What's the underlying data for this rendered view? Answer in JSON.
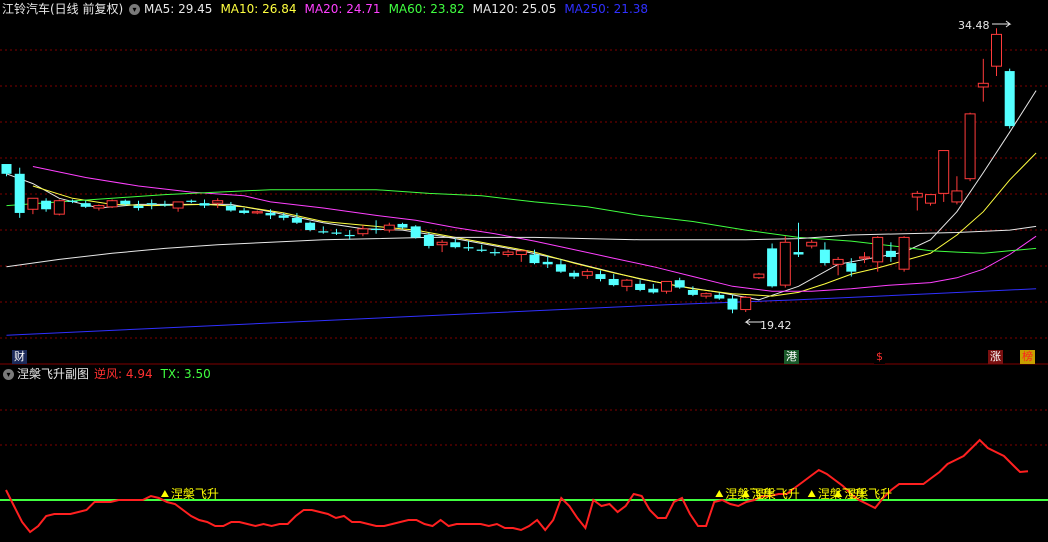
{
  "main_header": {
    "title": "江铃汽车(日线 前复权)",
    "menu_icon": "chevron-down-icon",
    "indicators": [
      {
        "label": "MA5:",
        "value": "29.45",
        "color": "#e8e8e8"
      },
      {
        "label": "MA10:",
        "value": "26.84",
        "color": "#ffff40"
      },
      {
        "label": "MA20:",
        "value": "24.71",
        "color": "#ff40ff"
      },
      {
        "label": "MA60:",
        "value": "23.82",
        "color": "#40ff40"
      },
      {
        "label": "MA120:",
        "value": "25.05",
        "color": "#e8e8e8"
      },
      {
        "label": "MA250:",
        "value": "21.38",
        "color": "#3030ff"
      }
    ]
  },
  "price_annotations": {
    "high": "34.48",
    "low": "19.42"
  },
  "event_tags": [
    {
      "text": "财",
      "bg": "#1c2a5a",
      "color": "#ffffff"
    },
    {
      "text": "港",
      "bg": "#1a5a2a",
      "color": "#ffffff"
    },
    {
      "text": "$",
      "bg": "#000000",
      "color": "#ff3030"
    },
    {
      "text": "涨",
      "bg": "#7a1010",
      "color": "#ffffff"
    },
    {
      "text": "榜",
      "bg": "#c8a000",
      "color": "#ff2020"
    }
  ],
  "sub_header": {
    "title": "涅槃飞升副图",
    "menu_icon": "chevron-down-icon",
    "indicators": [
      {
        "label": "逆风:",
        "value": "4.94",
        "color": "#ff3030"
      },
      {
        "label": "TX:",
        "value": "3.50",
        "color": "#40ff40"
      }
    ]
  },
  "signal_label": "涅槃飞升",
  "colors": {
    "up": "#ff3b3b",
    "down": "#54ffff",
    "grid": "#800000",
    "signal": "#ffff00",
    "threshold": "#40ff40",
    "indicator": "#ff2020"
  },
  "chart_data": {
    "type": "candlestick",
    "ohlc": [
      [
        23.4,
        23.2,
        22.4,
        22.6
      ],
      [
        22.6,
        23.1,
        19.0,
        19.4
      ],
      [
        19.7,
        20.6,
        19.3,
        20.6
      ],
      [
        20.4,
        20.6,
        19.5,
        19.7
      ],
      [
        19.3,
        20.5,
        19.2,
        20.4
      ],
      [
        20.4,
        20.5,
        20.2,
        20.3
      ],
      [
        20.2,
        20.4,
        19.8,
        19.9
      ],
      [
        19.8,
        20.1,
        19.6,
        20.0
      ],
      [
        19.9,
        20.5,
        19.8,
        20.4
      ],
      [
        20.4,
        20.5,
        20.0,
        20.1
      ],
      [
        20.0,
        20.4,
        19.6,
        19.8
      ],
      [
        20.2,
        20.5,
        19.7,
        20.1
      ],
      [
        20.1,
        20.4,
        19.9,
        20.0
      ],
      [
        19.8,
        20.3,
        19.5,
        20.3
      ],
      [
        20.4,
        20.5,
        20.2,
        20.3
      ],
      [
        20.2,
        20.5,
        19.8,
        20.0
      ],
      [
        20.2,
        20.6,
        19.8,
        20.4
      ],
      [
        20.0,
        20.3,
        19.5,
        19.6
      ],
      [
        19.6,
        19.8,
        19.3,
        19.4
      ],
      [
        19.4,
        19.6,
        19.3,
        19.5
      ],
      [
        19.4,
        19.7,
        18.9,
        19.2
      ],
      [
        19.2,
        19.4,
        18.8,
        19.0
      ],
      [
        19.0,
        19.4,
        18.5,
        18.6
      ],
      [
        18.6,
        18.7,
        17.9,
        18.0
      ],
      [
        17.9,
        18.3,
        17.7,
        17.8
      ],
      [
        17.8,
        18.1,
        17.6,
        17.7
      ],
      [
        17.6,
        18.0,
        17.2,
        17.5
      ],
      [
        17.7,
        18.4,
        17.5,
        18.1
      ],
      [
        18.1,
        18.8,
        17.7,
        18.0
      ],
      [
        18.0,
        18.6,
        17.8,
        18.4
      ],
      [
        18.5,
        18.6,
        18.1,
        18.2
      ],
      [
        18.3,
        18.4,
        17.3,
        17.4
      ],
      [
        17.6,
        17.8,
        16.5,
        16.7
      ],
      [
        16.8,
        17.2,
        16.2,
        17.0
      ],
      [
        17.0,
        17.3,
        16.5,
        16.6
      ],
      [
        16.6,
        17.1,
        16.3,
        16.5
      ],
      [
        16.4,
        16.8,
        16.2,
        16.3
      ],
      [
        16.2,
        16.5,
        15.9,
        16.1
      ],
      [
        16.0,
        16.4,
        15.8,
        16.2
      ],
      [
        16.0,
        16.3,
        15.4,
        16.3
      ],
      [
        16.0,
        16.4,
        15.2,
        15.3
      ],
      [
        15.4,
        15.9,
        14.9,
        15.2
      ],
      [
        15.2,
        15.6,
        14.5,
        14.6
      ],
      [
        14.5,
        14.7,
        14.0,
        14.2
      ],
      [
        14.3,
        14.8,
        14.0,
        14.6
      ],
      [
        14.4,
        14.7,
        13.8,
        14.0
      ],
      [
        14.0,
        14.4,
        13.4,
        13.5
      ],
      [
        13.4,
        14.0,
        13.0,
        13.9
      ],
      [
        13.6,
        13.9,
        13.0,
        13.1
      ],
      [
        13.2,
        13.6,
        12.8,
        12.9
      ],
      [
        13.0,
        13.8,
        12.8,
        13.8
      ],
      [
        13.9,
        14.1,
        13.2,
        13.3
      ],
      [
        13.1,
        13.4,
        12.6,
        12.7
      ],
      [
        12.6,
        12.9,
        12.4,
        12.8
      ],
      [
        12.7,
        12.9,
        12.3,
        12.4
      ],
      [
        12.4,
        12.7,
        11.2,
        11.5
      ],
      [
        11.5,
        12.6,
        11.3,
        12.5
      ],
      [
        14.1,
        14.5,
        14.0,
        14.4
      ],
      [
        16.5,
        16.9,
        13.3,
        13.4
      ],
      [
        13.5,
        17.5,
        13.3,
        17.0
      ],
      [
        16.2,
        18.6,
        15.8,
        16.0
      ],
      [
        16.7,
        17.2,
        16.5,
        17.0
      ],
      [
        16.4,
        17.0,
        15.1,
        15.3
      ],
      [
        15.2,
        15.8,
        14.3,
        15.6
      ],
      [
        15.3,
        15.7,
        14.2,
        14.6
      ],
      [
        15.7,
        16.2,
        15.3,
        15.8
      ],
      [
        15.4,
        17.5,
        14.6,
        17.4
      ],
      [
        16.3,
        17.0,
        15.4,
        15.8
      ],
      [
        14.8,
        17.5,
        14.6,
        17.4
      ],
      [
        20.7,
        21.2,
        19.6,
        21.0
      ],
      [
        20.2,
        20.9,
        20.0,
        20.9
      ],
      [
        21.0,
        24.5,
        20.3,
        24.5
      ],
      [
        20.3,
        22.4,
        20.1,
        21.2
      ],
      [
        22.2,
        27.6,
        22.0,
        27.5
      ],
      [
        29.7,
        32.0,
        28.5,
        30.0
      ],
      [
        31.4,
        34.5,
        30.6,
        34.0
      ],
      [
        31.0,
        31.2,
        26.3,
        26.5
      ]
    ],
    "ma": [
      {
        "name": "MA5",
        "color": "#e8e8e8",
        "pts": [
          [
            0,
            22.6
          ],
          [
            2,
            21.8
          ],
          [
            4,
            20.6
          ],
          [
            7,
            19.8
          ],
          [
            10,
            20.1
          ],
          [
            14,
            20.1
          ],
          [
            17,
            20.1
          ],
          [
            20,
            19.5
          ],
          [
            24,
            18.6
          ],
          [
            27,
            18.1
          ],
          [
            30,
            18.0
          ],
          [
            33,
            17.5
          ],
          [
            36,
            16.9
          ],
          [
            39,
            16.3
          ],
          [
            42,
            15.6
          ],
          [
            45,
            14.8
          ],
          [
            48,
            14.0
          ],
          [
            51,
            13.4
          ],
          [
            54,
            12.9
          ],
          [
            57,
            12.3
          ],
          [
            60,
            13.4
          ],
          [
            63,
            15.2
          ],
          [
            66,
            15.8
          ],
          [
            68,
            16.2
          ],
          [
            70,
            17.2
          ],
          [
            72,
            19.5
          ],
          [
            74,
            22.7
          ],
          [
            76,
            26.0
          ],
          [
            78,
            29.4
          ]
        ]
      },
      {
        "name": "MA10",
        "color": "#ffff40",
        "pts": [
          [
            2,
            21.6
          ],
          [
            5,
            20.6
          ],
          [
            8,
            20.1
          ],
          [
            11,
            20.0
          ],
          [
            15,
            20.1
          ],
          [
            18,
            19.9
          ],
          [
            21,
            19.4
          ],
          [
            24,
            18.7
          ],
          [
            28,
            18.3
          ],
          [
            31,
            18.0
          ],
          [
            34,
            17.4
          ],
          [
            37,
            16.8
          ],
          [
            40,
            16.2
          ],
          [
            43,
            15.3
          ],
          [
            46,
            14.5
          ],
          [
            49,
            13.8
          ],
          [
            52,
            13.2
          ],
          [
            55,
            12.8
          ],
          [
            58,
            12.6
          ],
          [
            60,
            12.9
          ],
          [
            62,
            13.6
          ],
          [
            64,
            14.4
          ],
          [
            66,
            14.9
          ],
          [
            68,
            15.5
          ],
          [
            70,
            16.1
          ],
          [
            72,
            17.6
          ],
          [
            74,
            19.5
          ],
          [
            76,
            22.1
          ],
          [
            78,
            24.3
          ]
        ]
      },
      {
        "name": "MA20",
        "color": "#ff40ff",
        "pts": [
          [
            2,
            23.2
          ],
          [
            6,
            22.3
          ],
          [
            10,
            21.6
          ],
          [
            14,
            21.1
          ],
          [
            18,
            20.8
          ],
          [
            20,
            20.3
          ],
          [
            24,
            19.8
          ],
          [
            28,
            19.2
          ],
          [
            31,
            18.8
          ],
          [
            34,
            18.2
          ],
          [
            37,
            17.7
          ],
          [
            40,
            17.1
          ],
          [
            43,
            16.4
          ],
          [
            46,
            15.7
          ],
          [
            49,
            15.0
          ],
          [
            52,
            14.2
          ],
          [
            55,
            13.4
          ],
          [
            58,
            13.0
          ],
          [
            61,
            13.0
          ],
          [
            64,
            13.2
          ],
          [
            67,
            13.5
          ],
          [
            70,
            13.7
          ],
          [
            72,
            14.1
          ],
          [
            74,
            14.8
          ],
          [
            76,
            16.0
          ],
          [
            78,
            17.5
          ]
        ]
      },
      {
        "name": "MA60",
        "color": "#40ff40",
        "pts": [
          [
            0,
            20.0
          ],
          [
            4,
            20.3
          ],
          [
            8,
            20.6
          ],
          [
            12,
            20.9
          ],
          [
            16,
            21.1
          ],
          [
            20,
            21.3
          ],
          [
            24,
            21.3
          ],
          [
            28,
            21.3
          ],
          [
            32,
            21.0
          ],
          [
            36,
            20.8
          ],
          [
            40,
            20.3
          ],
          [
            44,
            19.9
          ],
          [
            48,
            19.2
          ],
          [
            52,
            18.7
          ],
          [
            56,
            18.0
          ],
          [
            60,
            17.4
          ],
          [
            64,
            17.1
          ],
          [
            68,
            16.6
          ],
          [
            70,
            16.3
          ],
          [
            72,
            16.2
          ],
          [
            74,
            16.1
          ],
          [
            76,
            16.3
          ],
          [
            78,
            16.5
          ]
        ]
      },
      {
        "name": "MA120",
        "color": "#e8e8e8",
        "pts": [
          [
            0,
            15.0
          ],
          [
            4,
            15.6
          ],
          [
            8,
            16.1
          ],
          [
            12,
            16.5
          ],
          [
            16,
            16.8
          ],
          [
            20,
            17.0
          ],
          [
            24,
            17.2
          ],
          [
            28,
            17.3
          ],
          [
            32,
            17.4
          ],
          [
            36,
            17.4
          ],
          [
            40,
            17.4
          ],
          [
            44,
            17.3
          ],
          [
            48,
            17.2
          ],
          [
            52,
            17.2
          ],
          [
            56,
            17.2
          ],
          [
            60,
            17.3
          ],
          [
            64,
            17.6
          ],
          [
            68,
            17.7
          ],
          [
            72,
            17.8
          ],
          [
            76,
            18.0
          ],
          [
            78,
            18.3
          ]
        ]
      },
      {
        "name": "MA250",
        "color": "#3030ff",
        "pts": [
          [
            0,
            9.4
          ],
          [
            10,
            9.9
          ],
          [
            20,
            10.4
          ],
          [
            30,
            10.9
          ],
          [
            40,
            11.4
          ],
          [
            50,
            11.9
          ],
          [
            60,
            12.3
          ],
          [
            70,
            12.8
          ],
          [
            78,
            13.2
          ]
        ]
      }
    ],
    "oscillator": {
      "name": "逆风",
      "threshold_name": "TX",
      "threshold": 3.5,
      "values": [
        4.0,
        3.2,
        2.4,
        1.9,
        2.2,
        2.7,
        2.8,
        2.8,
        2.8,
        2.9,
        3.0,
        3.4,
        3.4,
        3.4,
        3.5,
        3.5,
        3.5,
        3.5,
        3.7,
        3.6,
        3.4,
        3.3,
        3.0,
        2.7,
        2.5,
        2.4,
        2.2,
        2.2,
        2.4,
        2.4,
        2.3,
        2.2,
        2.3,
        2.2,
        2.3,
        2.3,
        2.7,
        3.0,
        3.0,
        2.9,
        2.8,
        2.6,
        2.7,
        2.4,
        2.4,
        2.3,
        2.2,
        2.2,
        2.3,
        2.4,
        2.5,
        2.5,
        2.3,
        2.2,
        2.5,
        2.2,
        2.3,
        2.3,
        2.3,
        2.3,
        2.2,
        2.3,
        2.1,
        2.1,
        2.0,
        2.2,
        2.5,
        2.0,
        2.5,
        3.6,
        3.2,
        2.6,
        2.1,
        3.5,
        3.2,
        3.3,
        2.9,
        3.2,
        3.8,
        3.7,
        3.0,
        2.6,
        2.6,
        3.4,
        3.6,
        2.8,
        2.2,
        2.2,
        3.4,
        3.5,
        3.3,
        3.2,
        3.4,
        3.5,
        3.7,
        3.7,
        3.8,
        3.8,
        4.1,
        4.4,
        4.7,
        5.0,
        4.8,
        4.5,
        4.2,
        3.8,
        3.5,
        3.3,
        3.1,
        3.6,
        4.0,
        4.3,
        4.3,
        4.3,
        4.3,
        4.6,
        4.9,
        5.3,
        5.5,
        5.7,
        6.1,
        6.5,
        6.1,
        5.9,
        5.7,
        5.3,
        4.9,
        4.94
      ],
      "signals": [
        12,
        54,
        56,
        61,
        63
      ]
    }
  }
}
